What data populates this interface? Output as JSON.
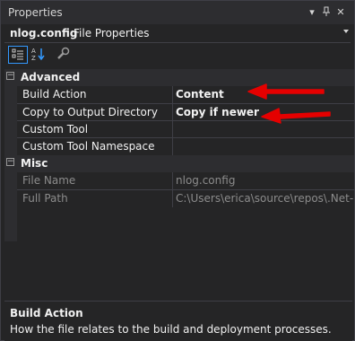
{
  "window": {
    "title": "Properties"
  },
  "selector": {
    "object": "nlog.config",
    "type": "File Properties"
  },
  "categories": [
    {
      "name": "Advanced",
      "rows": [
        {
          "name": "Build Action",
          "value": "Content"
        },
        {
          "name": "Copy to Output Directory",
          "value": "Copy if newer"
        },
        {
          "name": "Custom Tool",
          "value": ""
        },
        {
          "name": "Custom Tool Namespace",
          "value": ""
        }
      ]
    },
    {
      "name": "Misc",
      "rows": [
        {
          "name": "File Name",
          "value": "nlog.config"
        },
        {
          "name": "Full Path",
          "value": "C:\\Users\\erica\\source\\repos\\.Net-Co"
        }
      ]
    }
  ],
  "description": {
    "title": "Build Action",
    "text": "How the file relates to the build and deployment processes."
  },
  "colors": {
    "arrow": "#e50000",
    "accent": "#3399ff"
  }
}
